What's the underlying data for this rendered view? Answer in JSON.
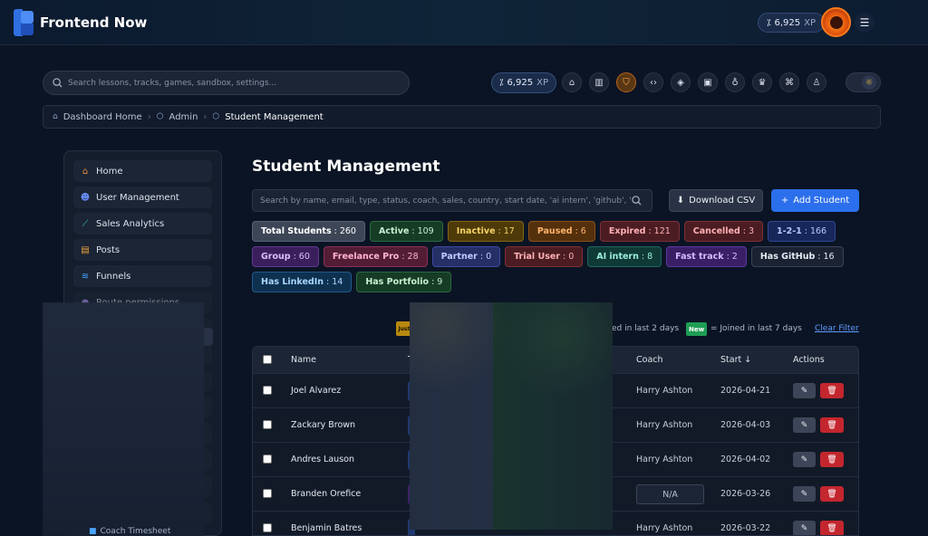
{
  "app": {
    "brand": "Frontend Now",
    "top_xp_value": "6,925",
    "xp_unit": "XP"
  },
  "search": {
    "placeholder": "Search lessons, tracks, games, sandbox, settings..."
  },
  "xp_pill": {
    "value": "6,925",
    "unit": "XP"
  },
  "breadcrumb": {
    "items": [
      "Dashboard Home",
      "Admin",
      "Student Management"
    ]
  },
  "sidebar": {
    "items": [
      {
        "label": "Home",
        "icon": "home-icon"
      },
      {
        "label": "User Management",
        "icon": "users-icon"
      },
      {
        "label": "Sales Analytics",
        "icon": "chart-icon"
      },
      {
        "label": "Posts",
        "icon": "posts-icon"
      },
      {
        "label": "Funnels",
        "icon": "layers-icon"
      },
      {
        "label": "Route permissions",
        "icon": "key-icon"
      }
    ],
    "bottom_label": "Coach Timesheet"
  },
  "main": {
    "title": "Student Management",
    "search_placeholder": "Search by name, email, type, status, coach, sales, country, start date, 'ai intern', 'github', 'linke",
    "download_label": "Download CSV",
    "add_label": "Add Student"
  },
  "badges": [
    {
      "label": "Total Students",
      "count": "260",
      "style": "gray"
    },
    {
      "label": "Active",
      "count": "109",
      "style": "green"
    },
    {
      "label": "Inactive",
      "count": "17",
      "style": "yellow"
    },
    {
      "label": "Paused",
      "count": "6",
      "style": "orange"
    },
    {
      "label": "Expired",
      "count": "121",
      "style": "red"
    },
    {
      "label": "Cancelled",
      "count": "3",
      "style": "red"
    },
    {
      "label": "1-2-1",
      "count": "166",
      "style": "blue"
    },
    {
      "label": "Group",
      "count": "60",
      "style": "purple"
    },
    {
      "label": "Freelance Pro",
      "count": "28",
      "style": "magenta"
    },
    {
      "label": "Partner",
      "count": "0",
      "style": "indigo"
    },
    {
      "label": "Trial User",
      "count": "0",
      "style": "red"
    },
    {
      "label": "AI intern",
      "count": "8",
      "style": "teal"
    },
    {
      "label": "Fast track",
      "count": "2",
      "style": "violet"
    },
    {
      "label": "Has GitHub",
      "count": "16",
      "style": "dark"
    },
    {
      "label": "Has LinkedIn",
      "count": "14",
      "style": "sky"
    },
    {
      "label": "Has Portfolio",
      "count": "9",
      "style": "green"
    }
  ],
  "legend": {
    "just_label": "Just",
    "joined_2": "ed in last 2 days",
    "new_label": "New",
    "joined_7": "= Joined in last 7 days",
    "clear": "Clear Filter"
  },
  "table": {
    "headers": {
      "name": "Name",
      "type_partial": "T",
      "coach": "Coach",
      "start": "Start ↓",
      "actions": "Actions"
    },
    "rows": [
      {
        "name": "Joel Alvarez",
        "coach": "Harry Ashton",
        "start": "2026-04-21",
        "type": "blue"
      },
      {
        "name": "Zackary Brown",
        "coach": "Harry Ashton",
        "start": "2026-04-03",
        "type": "blue"
      },
      {
        "name": "Andres Lauson",
        "coach": "Harry Ashton",
        "start": "2026-04-02",
        "type": "blue"
      },
      {
        "name": "Branden Orefice",
        "coach": "N/A",
        "start": "2026-03-26",
        "type": "purple"
      },
      {
        "name": "Benjamin Batres",
        "coach": "Harry Ashton",
        "start": "2026-03-22",
        "type": "blue"
      }
    ]
  }
}
